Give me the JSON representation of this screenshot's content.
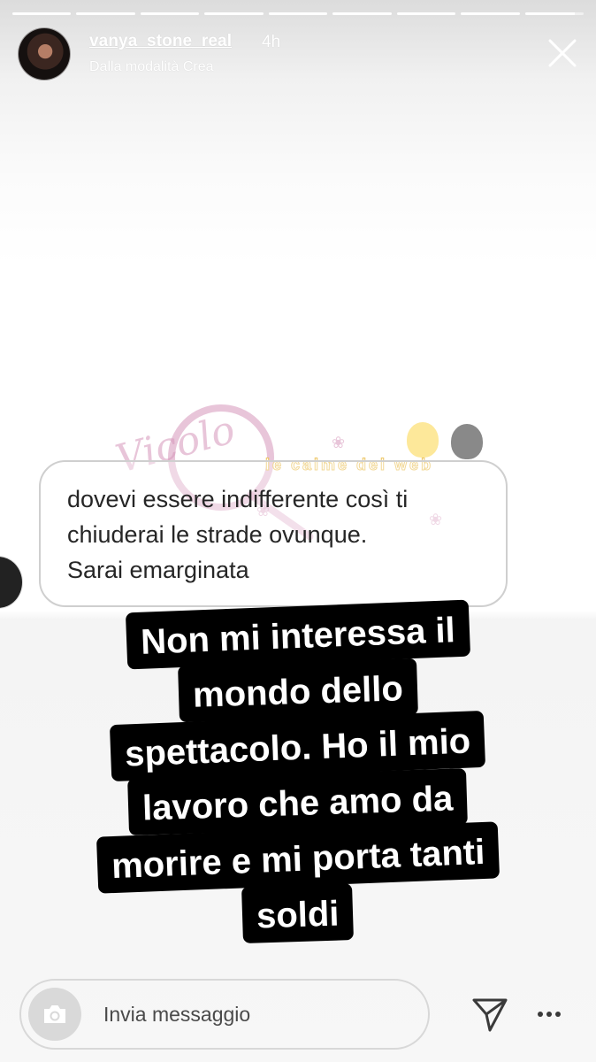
{
  "story": {
    "progress": {
      "segments": 9,
      "current_index": 8,
      "current_fraction": 0.85
    },
    "header": {
      "username": "vanya_stone_real",
      "time": "4h",
      "subtitle": "Dalla modalità Crea"
    },
    "question": {
      "lines": [
        "dovevi essere indifferente così ti",
        "chiuderai le strade ovunque.",
        "Sarai emarginata"
      ]
    },
    "watermark": {
      "script_text": "Vicolo",
      "band_text": "le calme del web"
    },
    "caption": {
      "lines": [
        "Non mi interessa il",
        "mondo dello",
        "spettacolo. Ho il mio",
        "lavoro che amo da",
        "morire e mi porta tanti",
        "soldi"
      ]
    },
    "bottom_bar": {
      "placeholder": "Invia messaggio"
    },
    "icons": {
      "close": "close-icon",
      "camera": "camera-icon",
      "send": "send-icon",
      "more": "more-icon"
    }
  }
}
